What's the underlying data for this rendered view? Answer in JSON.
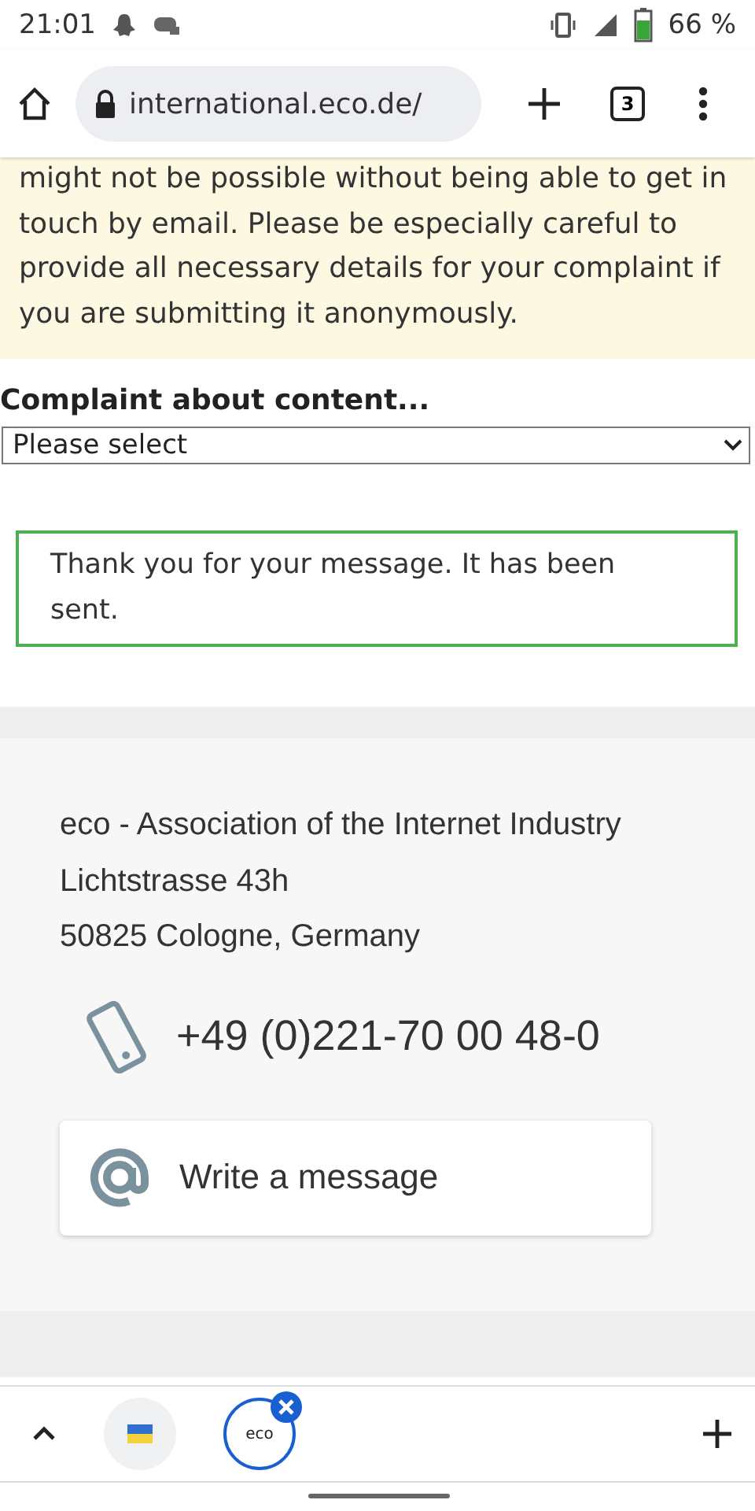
{
  "status_bar": {
    "time": "21:01",
    "battery": "66 %"
  },
  "browser": {
    "url": "international.eco.de/",
    "tab_count": "3"
  },
  "notice": "might not be possible without being able to get in touch by email. Please be especially careful to provide all necessary details for your complaint if you are submitting it anonymously.",
  "complaint_field": {
    "label": "Complaint about content...",
    "value": "Please select"
  },
  "success_message": "Thank you for your message. It has been sent.",
  "contact": {
    "address": [
      "eco - Association of the Internet Industry",
      "Lichtstrasse 43h",
      "50825 Cologne, Germany"
    ],
    "phone": "+49 (0)221-70 00 48-0",
    "message_button": "Write a message"
  },
  "tab_strip": [
    {
      "kind": "flag",
      "selected": false
    },
    {
      "kind": "logo",
      "logo_text": "eco",
      "selected": true
    }
  ]
}
